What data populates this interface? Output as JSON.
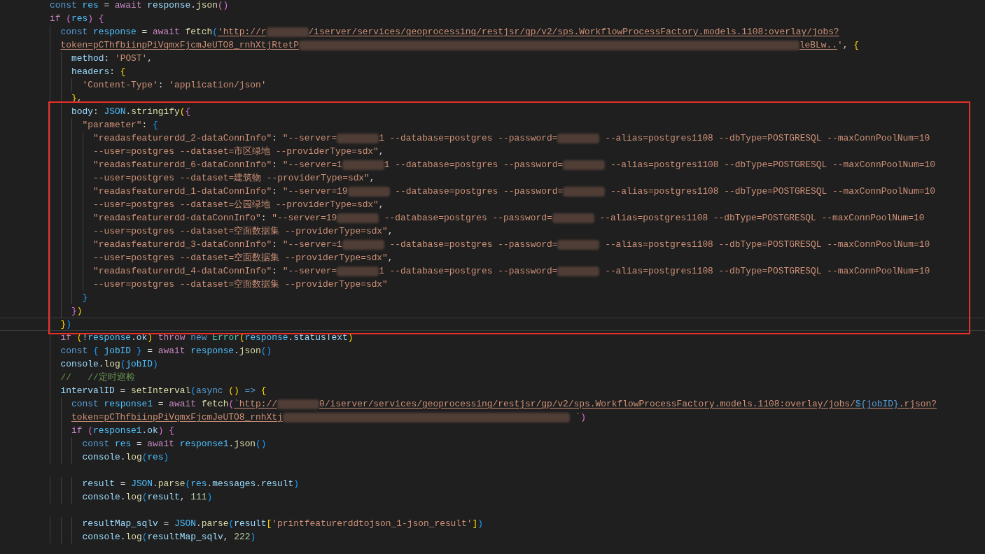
{
  "blocks": [
    {
      "highlighted": false,
      "lines": [
        {
          "kind": "code",
          "current": false,
          "tokens": [
            {
              "kind": "keyword",
              "text": "const "
            },
            {
              "kind": "constant",
              "text": "res"
            },
            {
              "kind": "plain",
              "text": " = "
            },
            {
              "kind": "control",
              "text": "await "
            },
            {
              "kind": "variable",
              "text": "response"
            },
            {
              "kind": "plain",
              "text": "."
            },
            {
              "kind": "function",
              "text": "json"
            },
            {
              "kind": "bracket-pink",
              "text": "()"
            }
          ]
        },
        {
          "kind": "code",
          "current": false,
          "tokens": [
            {
              "kind": "control",
              "text": "if "
            },
            {
              "kind": "bracket-pink",
              "text": "("
            },
            {
              "kind": "constant",
              "text": "res"
            },
            {
              "kind": "bracket-pink",
              "text": ") "
            },
            {
              "kind": "bracket-pink",
              "text": "{"
            }
          ]
        },
        {
          "kind": "code",
          "current": false,
          "tokens": [
            {
              "kind": "keyword",
              "text": "  const "
            },
            {
              "kind": "constant",
              "text": "response"
            },
            {
              "kind": "plain",
              "text": " = "
            },
            {
              "kind": "control",
              "text": "await "
            },
            {
              "kind": "function",
              "text": "fetch"
            },
            {
              "kind": "bracket-blue",
              "text": "("
            },
            {
              "kind": "link",
              "text": "'http://r"
            },
            {
              "kind": "redacted-short"
            },
            {
              "kind": "link",
              "text": "/iserver/services/geoprocessing/restjsr/gp/v2/sps.WorkflowProcessFactory.models.1108:overlay/jobs?"
            }
          ]
        },
        {
          "kind": "code",
          "current": false,
          "tokens": [
            {
              "kind": "link",
              "text": "  token=pCThfbiinpPiVqmxFjcmJeUTO8_rnhXtjRtetP"
            },
            {
              "kind": "redacted-long"
            },
            {
              "kind": "link",
              "text": "leBLw.."
            },
            {
              "kind": "string",
              "text": "'"
            },
            {
              "kind": "plain",
              "text": ", "
            },
            {
              "kind": "bracket-gold",
              "text": "{"
            }
          ]
        },
        {
          "kind": "code",
          "current": false,
          "tokens": [
            {
              "kind": "variable",
              "text": "    method"
            },
            {
              "kind": "plain",
              "text": ": "
            },
            {
              "kind": "string",
              "text": "'POST'"
            },
            {
              "kind": "plain",
              "text": ","
            }
          ]
        },
        {
          "kind": "code",
          "current": false,
          "tokens": [
            {
              "kind": "variable",
              "text": "    headers"
            },
            {
              "kind": "plain",
              "text": ": "
            },
            {
              "kind": "bracket-gold",
              "text": "{"
            }
          ]
        },
        {
          "kind": "code",
          "current": false,
          "tokens": [
            {
              "kind": "string",
              "text": "      'Content-Type'"
            },
            {
              "kind": "plain",
              "text": ": "
            },
            {
              "kind": "string",
              "text": "'application/json'"
            }
          ]
        },
        {
          "kind": "code",
          "current": false,
          "tokens": [
            {
              "kind": "bracket-gold",
              "text": "    }"
            },
            {
              "kind": "plain",
              "text": ","
            }
          ]
        }
      ]
    },
    {
      "highlighted": true,
      "lines": [
        {
          "kind": "code",
          "current": false,
          "tokens": [
            {
              "kind": "variable",
              "text": "    body"
            },
            {
              "kind": "plain",
              "text": ": "
            },
            {
              "kind": "constant",
              "text": "JSON"
            },
            {
              "kind": "plain",
              "text": "."
            },
            {
              "kind": "function",
              "text": "stringify"
            },
            {
              "kind": "bracket-gold",
              "text": "("
            },
            {
              "kind": "bracket-pink",
              "text": "{"
            }
          ]
        },
        {
          "kind": "code",
          "current": false,
          "tokens": [
            {
              "kind": "string",
              "text": "      \"parameter\""
            },
            {
              "kind": "plain",
              "text": ": "
            },
            {
              "kind": "bracket-blue",
              "text": "{"
            }
          ]
        },
        {
          "kind": "code",
          "current": false,
          "tokens": [
            {
              "kind": "string",
              "text": "        \"readasfeaturerdd_2-dataConnInfo\""
            },
            {
              "kind": "plain",
              "text": ": "
            },
            {
              "kind": "string",
              "text": "\"--server="
            },
            {
              "kind": "redacted-short"
            },
            {
              "kind": "string",
              "text": "1 --database=postgres --password="
            },
            {
              "kind": "redacted-short"
            },
            {
              "kind": "string",
              "text": " --alias=postgres1108 --dbType=POSTGRESQL --maxConnPoolNum=10"
            }
          ]
        },
        {
          "kind": "code",
          "current": false,
          "tokens": [
            {
              "kind": "string",
              "text": "        --user=postgres --dataset=市区绿地 --providerType=sdx\""
            },
            {
              "kind": "plain",
              "text": ","
            }
          ]
        },
        {
          "kind": "code",
          "current": false,
          "tokens": [
            {
              "kind": "string",
              "text": "        \"readasfeaturerdd_6-dataConnInfo\""
            },
            {
              "kind": "plain",
              "text": ": "
            },
            {
              "kind": "string",
              "text": "\"--server=1"
            },
            {
              "kind": "redacted-short"
            },
            {
              "kind": "string",
              "text": "1 --database=postgres --password="
            },
            {
              "kind": "redacted-short"
            },
            {
              "kind": "string",
              "text": " --alias=postgres1108 --dbType=POSTGRESQL --maxConnPoolNum=10"
            }
          ]
        },
        {
          "kind": "code",
          "current": false,
          "tokens": [
            {
              "kind": "string",
              "text": "        --user=postgres --dataset=建筑物 --providerType=sdx\""
            },
            {
              "kind": "plain",
              "text": ","
            }
          ]
        },
        {
          "kind": "code",
          "current": false,
          "tokens": [
            {
              "kind": "string",
              "text": "        \"readasfeaturerdd_1-dataConnInfo\""
            },
            {
              "kind": "plain",
              "text": ": "
            },
            {
              "kind": "string",
              "text": "\"--server=19"
            },
            {
              "kind": "redacted-short"
            },
            {
              "kind": "string",
              "text": " --database=postgres --password="
            },
            {
              "kind": "redacted-short"
            },
            {
              "kind": "string",
              "text": " --alias=postgres1108 --dbType=POSTGRESQL --maxConnPoolNum=10"
            }
          ]
        },
        {
          "kind": "code",
          "current": false,
          "tokens": [
            {
              "kind": "string",
              "text": "        --user=postgres --dataset=公园绿地 --providerType=sdx\""
            },
            {
              "kind": "plain",
              "text": ","
            }
          ]
        },
        {
          "kind": "code",
          "current": false,
          "tokens": [
            {
              "kind": "string",
              "text": "        \"readasfeaturerdd-dataConnInfo\""
            },
            {
              "kind": "plain",
              "text": ": "
            },
            {
              "kind": "string",
              "text": "\"--server=19"
            },
            {
              "kind": "redacted-short"
            },
            {
              "kind": "string",
              "text": " --database=postgres --password="
            },
            {
              "kind": "redacted-short"
            },
            {
              "kind": "string",
              "text": " --alias=postgres1108 --dbType=POSTGRESQL --maxConnPoolNum=10"
            }
          ]
        },
        {
          "kind": "code",
          "current": false,
          "tokens": [
            {
              "kind": "string",
              "text": "        --user=postgres --dataset=空面数据集 --providerType=sdx\""
            },
            {
              "kind": "plain",
              "text": ","
            }
          ]
        },
        {
          "kind": "code",
          "current": false,
          "tokens": [
            {
              "kind": "string",
              "text": "        \"readasfeaturerdd_3-dataConnInfo\""
            },
            {
              "kind": "plain",
              "text": ": "
            },
            {
              "kind": "string",
              "text": "\"--server=1"
            },
            {
              "kind": "redacted-short"
            },
            {
              "kind": "string",
              "text": " --database=postgres --password="
            },
            {
              "kind": "redacted-short"
            },
            {
              "kind": "string",
              "text": " --alias=postgres1108 --dbType=POSTGRESQL --maxConnPoolNum=10"
            }
          ]
        },
        {
          "kind": "code",
          "current": false,
          "tokens": [
            {
              "kind": "string",
              "text": "        --user=postgres --dataset=空面数据集 --providerType=sdx\""
            },
            {
              "kind": "plain",
              "text": ","
            }
          ]
        },
        {
          "kind": "code",
          "current": false,
          "tokens": [
            {
              "kind": "string",
              "text": "        \"readasfeaturerdd_4-dataConnInfo\""
            },
            {
              "kind": "plain",
              "text": ": "
            },
            {
              "kind": "string",
              "text": "\"--server="
            },
            {
              "kind": "redacted-short"
            },
            {
              "kind": "string",
              "text": "1 --database=postgres --password="
            },
            {
              "kind": "redacted-short"
            },
            {
              "kind": "string",
              "text": " --alias=postgres1108 --dbType=POSTGRESQL --maxConnPoolNum=10"
            }
          ]
        },
        {
          "kind": "code",
          "current": false,
          "tokens": [
            {
              "kind": "string",
              "text": "        --user=postgres --dataset=空面数据集 --providerType=sdx\""
            }
          ]
        },
        {
          "kind": "code",
          "current": false,
          "tokens": [
            {
              "kind": "bracket-blue",
              "text": "      }"
            }
          ]
        },
        {
          "kind": "code",
          "current": false,
          "tokens": [
            {
              "kind": "bracket-pink",
              "text": "    }"
            },
            {
              "kind": "bracket-gold",
              "text": ")"
            }
          ]
        },
        {
          "kind": "code",
          "current": true,
          "tokens": [
            {
              "kind": "bracket-gold",
              "text": "  }"
            },
            {
              "kind": "bracket-blue",
              "text": ")"
            }
          ]
        }
      ]
    },
    {
      "highlighted": false,
      "lines": [
        {
          "kind": "code",
          "current": false,
          "tokens": [
            {
              "kind": "control",
              "text": "  if "
            },
            {
              "kind": "bracket-gold",
              "text": "("
            },
            {
              "kind": "plain",
              "text": "!"
            },
            {
              "kind": "constant",
              "text": "response"
            },
            {
              "kind": "plain",
              "text": "."
            },
            {
              "kind": "variable",
              "text": "ok"
            },
            {
              "kind": "bracket-gold",
              "text": ") "
            },
            {
              "kind": "control",
              "text": "throw "
            },
            {
              "kind": "keyword",
              "text": "new "
            },
            {
              "kind": "type",
              "text": "Error"
            },
            {
              "kind": "bracket-gold",
              "text": "("
            },
            {
              "kind": "constant",
              "text": "response"
            },
            {
              "kind": "plain",
              "text": "."
            },
            {
              "kind": "variable",
              "text": "statusText"
            },
            {
              "kind": "bracket-gold",
              "text": ")"
            }
          ]
        },
        {
          "kind": "code",
          "current": false,
          "tokens": [
            {
              "kind": "keyword",
              "text": "  const "
            },
            {
              "kind": "bracket-blue",
              "text": "{ "
            },
            {
              "kind": "constant",
              "text": "jobID "
            },
            {
              "kind": "bracket-blue",
              "text": "}"
            },
            {
              "kind": "plain",
              "text": " = "
            },
            {
              "kind": "control",
              "text": "await "
            },
            {
              "kind": "constant",
              "text": "response"
            },
            {
              "kind": "plain",
              "text": "."
            },
            {
              "kind": "function",
              "text": "json"
            },
            {
              "kind": "bracket-blue",
              "text": "()"
            }
          ]
        },
        {
          "kind": "code",
          "current": false,
          "tokens": [
            {
              "kind": "variable",
              "text": "  console"
            },
            {
              "kind": "plain",
              "text": "."
            },
            {
              "kind": "function",
              "text": "log"
            },
            {
              "kind": "bracket-blue",
              "text": "("
            },
            {
              "kind": "constant",
              "text": "jobID"
            },
            {
              "kind": "bracket-blue",
              "text": ")"
            }
          ]
        },
        {
          "kind": "code",
          "current": false,
          "tokens": [
            {
              "kind": "comment",
              "text": "  //   //定时巡检"
            }
          ]
        },
        {
          "kind": "code",
          "current": false,
          "tokens": [
            {
              "kind": "variable",
              "text": "  intervalID"
            },
            {
              "kind": "plain",
              "text": " = "
            },
            {
              "kind": "function",
              "text": "setInterval"
            },
            {
              "kind": "bracket-blue",
              "text": "("
            },
            {
              "kind": "keyword",
              "text": "async "
            },
            {
              "kind": "bracket-gold",
              "text": "() "
            },
            {
              "kind": "keyword",
              "text": "=> "
            },
            {
              "kind": "bracket-gold",
              "text": "{"
            }
          ]
        },
        {
          "kind": "code",
          "current": false,
          "tokens": [
            {
              "kind": "keyword",
              "text": "    const "
            },
            {
              "kind": "constant",
              "text": "response1"
            },
            {
              "kind": "plain",
              "text": " = "
            },
            {
              "kind": "control",
              "text": "await "
            },
            {
              "kind": "function",
              "text": "fetch"
            },
            {
              "kind": "bracket-pink",
              "text": "("
            },
            {
              "kind": "link",
              "text": "`http://"
            },
            {
              "kind": "redacted-short"
            },
            {
              "kind": "link",
              "text": "0/iserver/services/geoprocessing/restjsr/gp/v2/sps.WorkflowProcessFactory.models.1108:overlay/jobs/"
            },
            {
              "kind": "embed",
              "text": "${jobID}"
            },
            {
              "kind": "link",
              "text": ".rjson?"
            }
          ]
        },
        {
          "kind": "code",
          "current": false,
          "tokens": [
            {
              "kind": "link",
              "text": "    token=pCThfbiinpPiVqmxFjcmJeUTO8_rnhXtj"
            },
            {
              "kind": "redacted-medium"
            },
            {
              "kind": "string",
              "text": " `"
            },
            {
              "kind": "bracket-pink",
              "text": ")"
            }
          ]
        },
        {
          "kind": "code",
          "current": false,
          "tokens": [
            {
              "kind": "control",
              "text": "    if "
            },
            {
              "kind": "bracket-pink",
              "text": "("
            },
            {
              "kind": "constant",
              "text": "response1"
            },
            {
              "kind": "plain",
              "text": "."
            },
            {
              "kind": "variable",
              "text": "ok"
            },
            {
              "kind": "bracket-pink",
              "text": ") "
            },
            {
              "kind": "bracket-pink",
              "text": "{"
            }
          ]
        },
        {
          "kind": "code",
          "current": false,
          "tokens": [
            {
              "kind": "keyword",
              "text": "      const "
            },
            {
              "kind": "constant",
              "text": "res"
            },
            {
              "kind": "plain",
              "text": " = "
            },
            {
              "kind": "control",
              "text": "await "
            },
            {
              "kind": "constant",
              "text": "response1"
            },
            {
              "kind": "plain",
              "text": "."
            },
            {
              "kind": "function",
              "text": "json"
            },
            {
              "kind": "bracket-blue",
              "text": "()"
            }
          ]
        },
        {
          "kind": "code",
          "current": false,
          "tokens": [
            {
              "kind": "variable",
              "text": "      console"
            },
            {
              "kind": "plain",
              "text": "."
            },
            {
              "kind": "function",
              "text": "log"
            },
            {
              "kind": "bracket-blue",
              "text": "("
            },
            {
              "kind": "constant",
              "text": "res"
            },
            {
              "kind": "bracket-blue",
              "text": ")"
            }
          ]
        },
        {
          "kind": "blank"
        },
        {
          "kind": "code",
          "current": false,
          "tokens": [
            {
              "kind": "variable",
              "text": "      result"
            },
            {
              "kind": "plain",
              "text": " = "
            },
            {
              "kind": "constant",
              "text": "JSON"
            },
            {
              "kind": "plain",
              "text": "."
            },
            {
              "kind": "function",
              "text": "parse"
            },
            {
              "kind": "bracket-blue",
              "text": "("
            },
            {
              "kind": "constant",
              "text": "res"
            },
            {
              "kind": "plain",
              "text": "."
            },
            {
              "kind": "variable",
              "text": "messages"
            },
            {
              "kind": "plain",
              "text": "."
            },
            {
              "kind": "variable",
              "text": "result"
            },
            {
              "kind": "bracket-blue",
              "text": ")"
            }
          ]
        },
        {
          "kind": "code",
          "current": false,
          "tokens": [
            {
              "kind": "variable",
              "text": "      console"
            },
            {
              "kind": "plain",
              "text": "."
            },
            {
              "kind": "function",
              "text": "log"
            },
            {
              "kind": "bracket-blue",
              "text": "("
            },
            {
              "kind": "variable",
              "text": "result"
            },
            {
              "kind": "plain",
              "text": ", "
            },
            {
              "kind": "number",
              "text": "111"
            },
            {
              "kind": "bracket-blue",
              "text": ")"
            }
          ]
        },
        {
          "kind": "blank"
        },
        {
          "kind": "code",
          "current": false,
          "tokens": [
            {
              "kind": "variable",
              "text": "      resultMap_sqlv"
            },
            {
              "kind": "plain",
              "text": " = "
            },
            {
              "kind": "constant",
              "text": "JSON"
            },
            {
              "kind": "plain",
              "text": "."
            },
            {
              "kind": "function",
              "text": "parse"
            },
            {
              "kind": "bracket-blue",
              "text": "("
            },
            {
              "kind": "variable",
              "text": "result"
            },
            {
              "kind": "bracket-gold",
              "text": "["
            },
            {
              "kind": "string",
              "text": "'printfeaturerddtojson_1-json_result'"
            },
            {
              "kind": "bracket-gold",
              "text": "]"
            },
            {
              "kind": "bracket-blue",
              "text": ")"
            }
          ]
        },
        {
          "kind": "code",
          "current": false,
          "tokens": [
            {
              "kind": "variable",
              "text": "      console"
            },
            {
              "kind": "plain",
              "text": "."
            },
            {
              "kind": "function",
              "text": "log"
            },
            {
              "kind": "bracket-blue",
              "text": "("
            },
            {
              "kind": "variable",
              "text": "resultMap_sqlv"
            },
            {
              "kind": "plain",
              "text": ", "
            },
            {
              "kind": "number",
              "text": "222"
            },
            {
              "kind": "bracket-blue",
              "text": ")"
            }
          ]
        }
      ]
    }
  ]
}
